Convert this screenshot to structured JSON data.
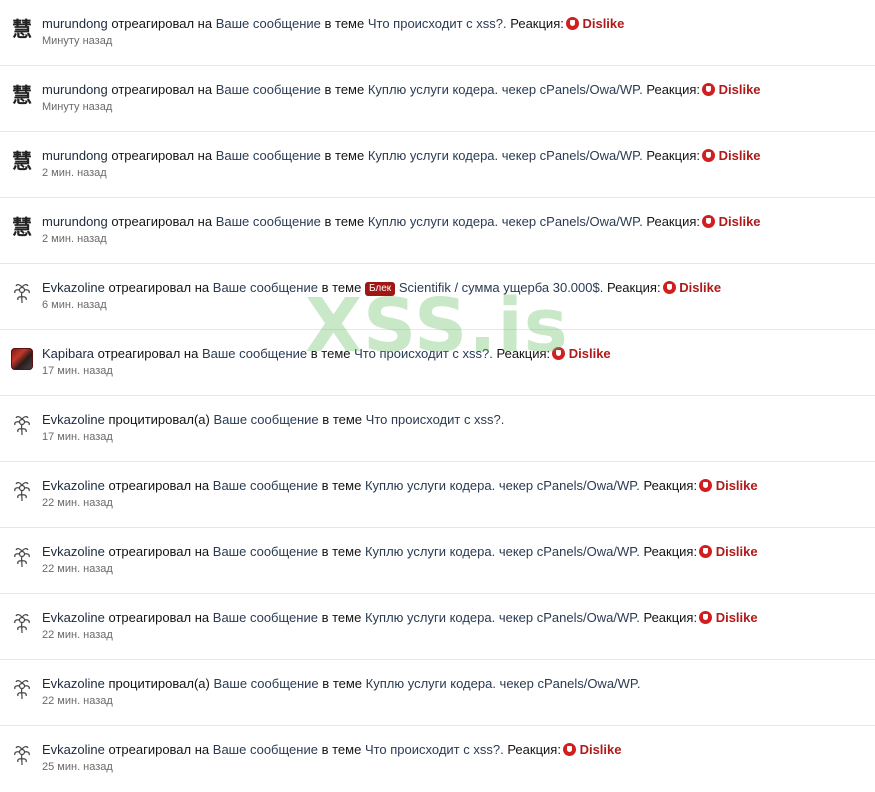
{
  "watermark": "XSS.is",
  "alerts": [
    {
      "user": "murundong",
      "verb": "отреагировал на",
      "object": "Ваше сообщение",
      "in_thread": "в теме",
      "thread": "Что происходит с xss?.",
      "reaction_prefix": "Реакция:",
      "reaction": "Dislike",
      "time": "Минуту назад",
      "avatar": "慧"
    },
    {
      "user": "murundong",
      "verb": "отреагировал на",
      "object": "Ваше сообщение",
      "in_thread": "в теме",
      "thread": "Куплю услуги кодера. чекер cPanels/Owa/WP.",
      "reaction_prefix": "Реакция:",
      "reaction": "Dislike",
      "time": "Минуту назад",
      "avatar": "慧"
    },
    {
      "user": "murundong",
      "verb": "отреагировал на",
      "object": "Ваше сообщение",
      "in_thread": "в теме",
      "thread": "Куплю услуги кодера. чекер cPanels/Owa/WP.",
      "reaction_prefix": "Реакция:",
      "reaction": "Dislike",
      "time": "2 мин. назад",
      "avatar": "慧"
    },
    {
      "user": "murundong",
      "verb": "отреагировал на",
      "object": "Ваше сообщение",
      "in_thread": "в теме",
      "thread": "Куплю услуги кодера. чекер cPanels/Owa/WP.",
      "reaction_prefix": "Реакция:",
      "reaction": "Dislike",
      "time": "2 мин. назад",
      "avatar": "慧"
    },
    {
      "user": "Evkazoline",
      "verb": "отреагировал на",
      "object": "Ваше сообщение",
      "in_thread": "в теме",
      "prefix_tag": "Блек",
      "thread": "Scientifik / сумма ущерба 30.000$.",
      "reaction_prefix": "Реакция:",
      "reaction": "Dislike",
      "time": "6 мин. назад",
      "avatar": "flower"
    },
    {
      "user": "Kapibara",
      "verb": "отреагировал на",
      "object": "Ваше сообщение",
      "in_thread": "в теме",
      "thread": "Что происходит с xss?.",
      "reaction_prefix": "Реакция:",
      "reaction": "Dislike",
      "time": "17 мин. назад",
      "avatar": "kapibara"
    },
    {
      "user": "Evkazoline",
      "verb": "процитировал(а)",
      "object": "Ваше сообщение",
      "in_thread": "в теме",
      "thread": "Что происходит с xss?.",
      "time": "17 мин. назад",
      "avatar": "flower"
    },
    {
      "user": "Evkazoline",
      "verb": "отреагировал на",
      "object": "Ваше сообщение",
      "in_thread": "в теме",
      "thread": "Куплю услуги кодера. чекер cPanels/Owa/WP.",
      "reaction_prefix": "Реакция:",
      "reaction": "Dislike",
      "time": "22 мин. назад",
      "avatar": "flower"
    },
    {
      "user": "Evkazoline",
      "verb": "отреагировал на",
      "object": "Ваше сообщение",
      "in_thread": "в теме",
      "thread": "Куплю услуги кодера. чекер cPanels/Owa/WP.",
      "reaction_prefix": "Реакция:",
      "reaction": "Dislike",
      "time": "22 мин. назад",
      "avatar": "flower"
    },
    {
      "user": "Evkazoline",
      "verb": "отреагировал на",
      "object": "Ваше сообщение",
      "in_thread": "в теме",
      "thread": "Куплю услуги кодера. чекер cPanels/Owa/WP.",
      "reaction_prefix": "Реакция:",
      "reaction": "Dislike",
      "time": "22 мин. назад",
      "avatar": "flower"
    },
    {
      "user": "Evkazoline",
      "verb": "процитировал(а)",
      "object": "Ваше сообщение",
      "in_thread": "в теме",
      "thread": "Куплю услуги кодера. чекер cPanels/Owa/WP.",
      "time": "22 мин. назад",
      "avatar": "flower"
    },
    {
      "user": "Evkazoline",
      "verb": "отреагировал на",
      "object": "Ваше сообщение",
      "in_thread": "в теме",
      "thread": "Что происходит с xss?.",
      "reaction_prefix": "Реакция:",
      "reaction": "Dislike",
      "time": "25 мин. назад",
      "avatar": "flower"
    }
  ],
  "colors": {
    "reaction": "#b01a1a",
    "tag": "#a11515",
    "watermark": "#60be60"
  }
}
